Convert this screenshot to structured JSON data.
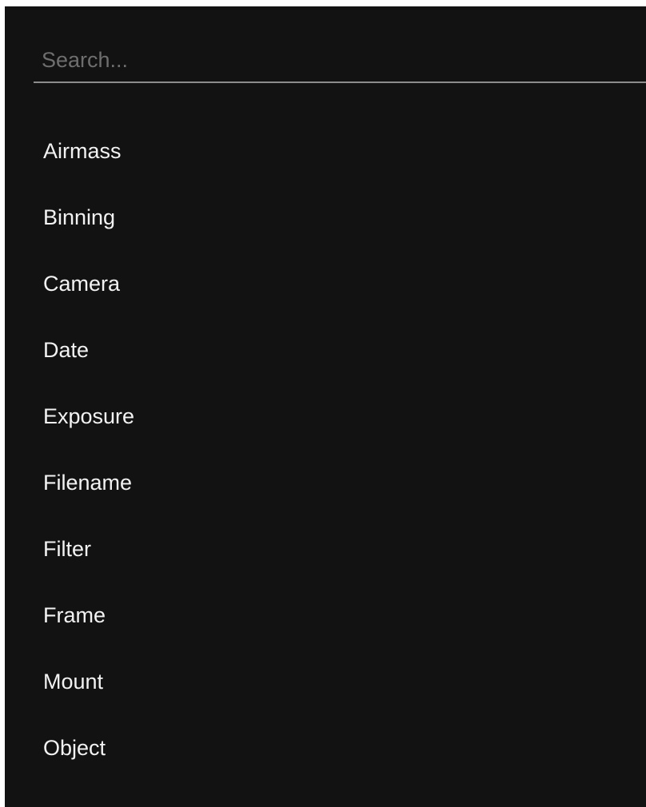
{
  "search": {
    "placeholder": "Search...",
    "value": ""
  },
  "list": {
    "items": [
      {
        "label": "Airmass"
      },
      {
        "label": "Binning"
      },
      {
        "label": "Camera"
      },
      {
        "label": "Date"
      },
      {
        "label": "Exposure"
      },
      {
        "label": "Filename"
      },
      {
        "label": "Filter"
      },
      {
        "label": "Frame"
      },
      {
        "label": "Mount"
      },
      {
        "label": "Object"
      }
    ]
  },
  "colors": {
    "background": "#121212",
    "text": "#f2f2f2",
    "placeholder": "#6e6e6e",
    "underline": "#8c8c8c"
  }
}
